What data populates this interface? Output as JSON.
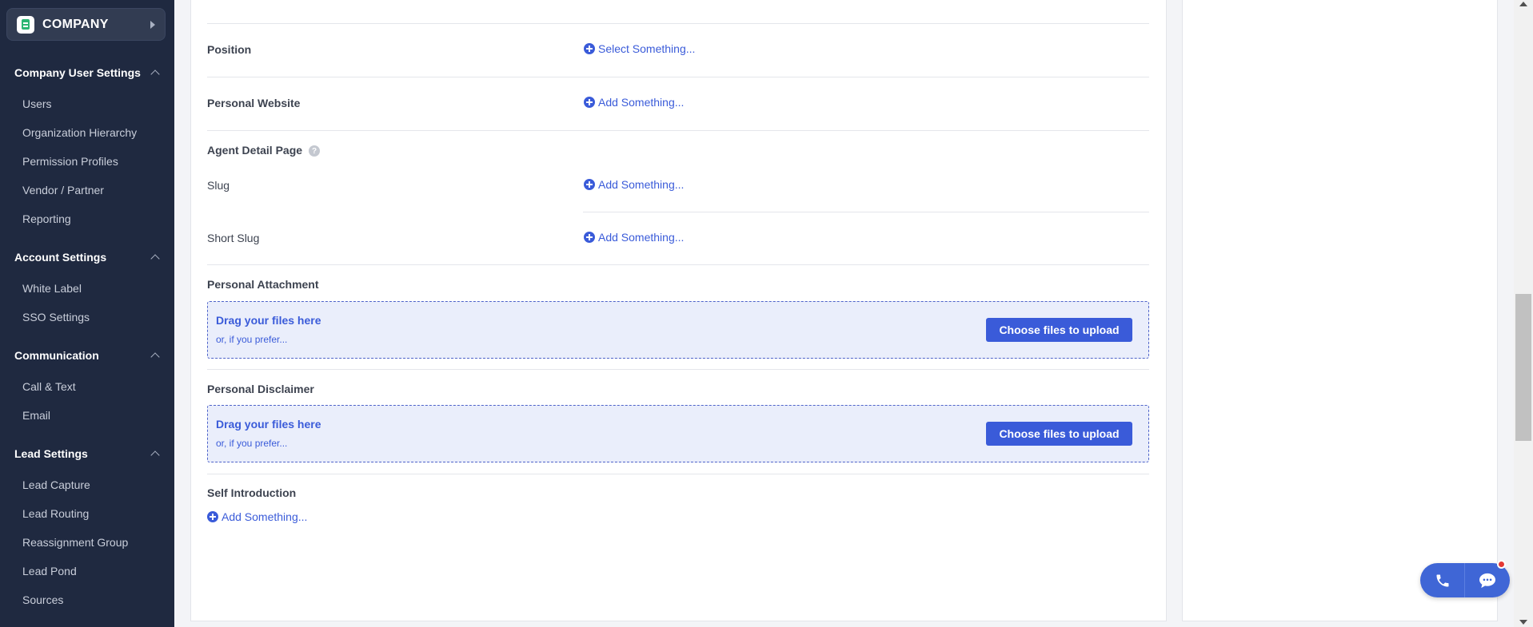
{
  "sidebar": {
    "company": "COMPANY",
    "groups": [
      {
        "title": "Company User Settings",
        "items": [
          "Users",
          "Organization Hierarchy",
          "Permission Profiles",
          "Vendor / Partner",
          "Reporting"
        ]
      },
      {
        "title": "Account Settings",
        "items": [
          "White Label",
          "SSO Settings"
        ]
      },
      {
        "title": "Communication",
        "items": [
          "Call & Text",
          "Email"
        ]
      },
      {
        "title": "Lead Settings",
        "items": [
          "Lead Capture",
          "Lead Routing",
          "Reassignment Group",
          "Lead Pond",
          "Sources"
        ]
      }
    ]
  },
  "form": {
    "position_label": "Position",
    "position_action": "Select Something...",
    "website_label": "Personal Website",
    "website_action": "Add Something...",
    "agent_detail_label": "Agent Detail Page",
    "slug_label": "Slug",
    "slug_action": "Add Something...",
    "short_slug_label": "Short Slug",
    "short_slug_action": "Add Something...",
    "attachment_label": "Personal Attachment",
    "disclaimer_label": "Personal Disclaimer",
    "self_intro_label": "Self Introduction",
    "self_intro_action": "Add Something..."
  },
  "dropzone": {
    "title": "Drag your files here",
    "subtitle": "or, if you prefer...",
    "button": "Choose files to upload"
  },
  "colors": {
    "sidebar_bg": "#1f2940",
    "accent": "#3a5bd9",
    "dropzone_bg": "#eaeefb"
  }
}
